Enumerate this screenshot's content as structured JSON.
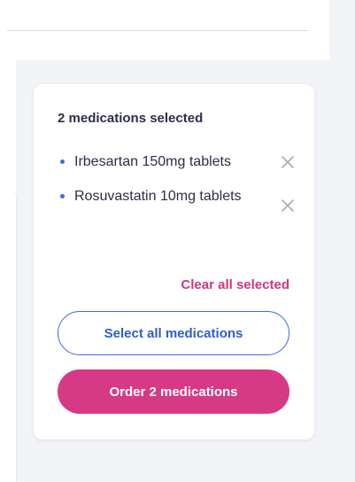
{
  "selection_panel": {
    "title": "2 medications selected",
    "medications": [
      {
        "name": "Irbesartan 150mg tablets"
      },
      {
        "name": "Rosuvastatin 10mg tablets"
      }
    ],
    "clear_label": "Clear all selected",
    "select_all_label": "Select all medications",
    "order_label": "Order 2 medications"
  },
  "icons": {
    "remove": "close-icon",
    "bullet": "bullet-dot"
  },
  "colors": {
    "accent_pink": "#d63a84",
    "accent_blue": "#3d6cd8",
    "text_dark": "#2b2e48",
    "page_background": "#f3f4f8"
  }
}
